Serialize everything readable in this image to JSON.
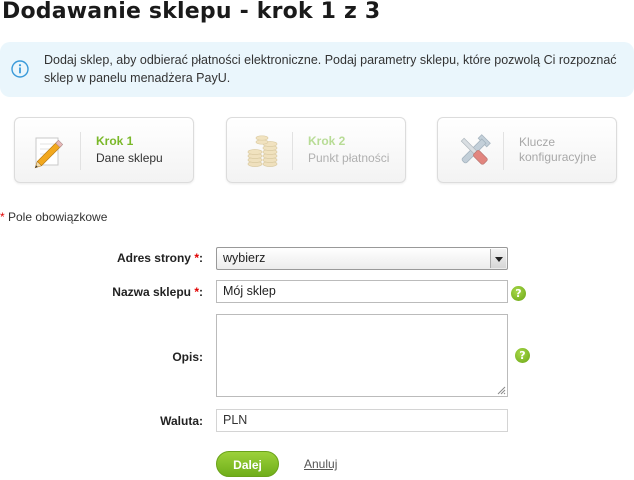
{
  "page": {
    "title": "Dodawanie sklepu - krok 1 z 3"
  },
  "info": {
    "icon": "info-icon",
    "text": "Dodaj sklep, aby odbierać płatności elektroniczne. Podaj parametry sklepu, które pozwolą Ci rozpoznać sklep w panelu menadżera PayU."
  },
  "steps": [
    {
      "icon": "pencil-icon",
      "title": "Krok 1",
      "subtitle": "Dane sklepu",
      "state": "active"
    },
    {
      "icon": "coins-icon",
      "title": "Krok 2",
      "subtitle": "Punkt płatności",
      "state": "inactive"
    },
    {
      "icon": "tools-icon",
      "title": "Klucze konfiguracyjne",
      "state": "inactive"
    }
  ],
  "required_note": {
    "star": "*",
    "text": " Pole obowiązkowe"
  },
  "form": {
    "address": {
      "label": "Adres strony",
      "required_star": " *",
      "colon": ":",
      "value": "wybierz"
    },
    "name": {
      "label": "Nazwa sklepu",
      "required_star": " *",
      "colon": ":",
      "value": "Mój sklep"
    },
    "description": {
      "label": "Opis:",
      "value": ""
    },
    "currency": {
      "label": "Waluta:",
      "value": "PLN"
    },
    "help_glyph": "?"
  },
  "actions": {
    "next_label": "Dalej",
    "cancel_label": "Anuluj"
  },
  "colors": {
    "accent_green": "#7ab829",
    "info_bg": "#eaf6fc",
    "required_red": "#e10000"
  }
}
